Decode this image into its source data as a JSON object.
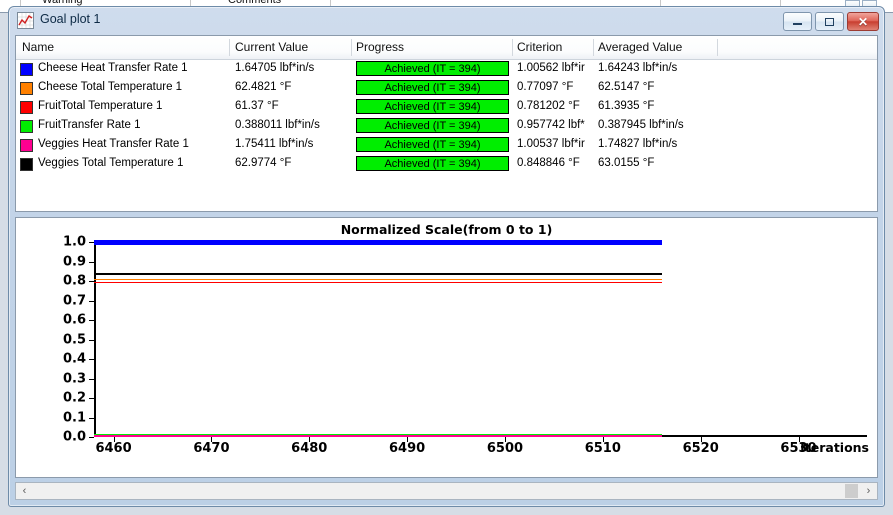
{
  "background_window": {
    "cells": [
      {
        "label": "Warning",
        "x": 42
      },
      {
        "label": "Comments",
        "x": 228
      }
    ]
  },
  "window": {
    "title": "Goal plot 1",
    "icon": "line-chart-icon",
    "controls": {
      "minimize": "minimize-icon",
      "maximize": "restore-icon",
      "close": "✕"
    }
  },
  "table": {
    "columns": [
      "Name",
      "Current Value",
      "Progress",
      "Criterion",
      "Averaged Value"
    ],
    "rows": [
      {
        "color": "#0000ff",
        "name": "Cheese Heat Transfer Rate 1",
        "current_value": "1.64705 lbf*in/s",
        "progress": "Achieved (IT = 394)",
        "criterion": "1.00562 lbf*ir",
        "averaged_value": "1.64243 lbf*in/s"
      },
      {
        "color": "#ff8000",
        "name": "Cheese Total Temperature 1",
        "current_value": "62.4821 °F",
        "progress": "Achieved (IT = 394)",
        "criterion": "0.77097 °F",
        "averaged_value": "62.5147 °F"
      },
      {
        "color": "#ff0000",
        "name": "FruitTotal Temperature 1",
        "current_value": "61.37 °F",
        "progress": "Achieved (IT = 394)",
        "criterion": "0.781202 °F",
        "averaged_value": "61.3935 °F"
      },
      {
        "color": "#00ee00",
        "name": "FruitTransfer Rate 1",
        "current_value": "0.388011 lbf*in/s",
        "progress": "Achieved (IT = 394)",
        "criterion": "0.957742 lbf*",
        "averaged_value": "0.387945 lbf*in/s"
      },
      {
        "color": "#ff0090",
        "name": "Veggies Heat Transfer Rate 1",
        "current_value": "1.75411 lbf*in/s",
        "progress": "Achieved (IT = 394)",
        "criterion": "1.00537 lbf*ir",
        "averaged_value": "1.74827 lbf*in/s"
      },
      {
        "color": "#000000",
        "name": "Veggies Total Temperature 1",
        "current_value": "62.9774 °F",
        "progress": "Achieved (IT = 394)",
        "criterion": "0.848846 °F",
        "averaged_value": "63.0155 °F"
      }
    ]
  },
  "chart_data": {
    "type": "line",
    "title": "Normalized Scale(from 0 to 1)",
    "xlabel": "Iterations",
    "ylabel": "",
    "xlim": [
      6458,
      6537
    ],
    "ylim": [
      0,
      1
    ],
    "xticks": [
      6460,
      6470,
      6480,
      6490,
      6500,
      6510,
      6520,
      6530
    ],
    "yticks": [
      "0.0",
      "0.1",
      "0.2",
      "0.3",
      "0.4",
      "0.5",
      "0.6",
      "0.7",
      "0.8",
      "0.9",
      "1.0"
    ],
    "grid": false,
    "legend": "none",
    "data_x_end": 6516,
    "series": [
      {
        "name": "Cheese Heat Transfer Rate 1",
        "color": "#0000ff",
        "value": 1.0,
        "width": 5
      },
      {
        "name": "Veggies Total Temperature 1",
        "color": "#000000",
        "value": 0.836,
        "width": 1.5
      },
      {
        "name": "Cheese Total Temperature 1",
        "color": "#ff8000",
        "value": 0.807,
        "width": 1.5
      },
      {
        "name": "FruitTotal Temperature 1",
        "color": "#ff0000",
        "value": 0.792,
        "width": 1.5
      },
      {
        "name": "FruitTransfer Rate 1",
        "color": "#00ee00",
        "value": 0.011,
        "width": 1.5
      },
      {
        "name": "Veggies Heat Transfer Rate 1",
        "color": "#ff0090",
        "value": 0.004,
        "width": 1.5
      }
    ]
  },
  "scrollbar": {
    "left_arrow": "‹",
    "right_arrow": "›"
  }
}
